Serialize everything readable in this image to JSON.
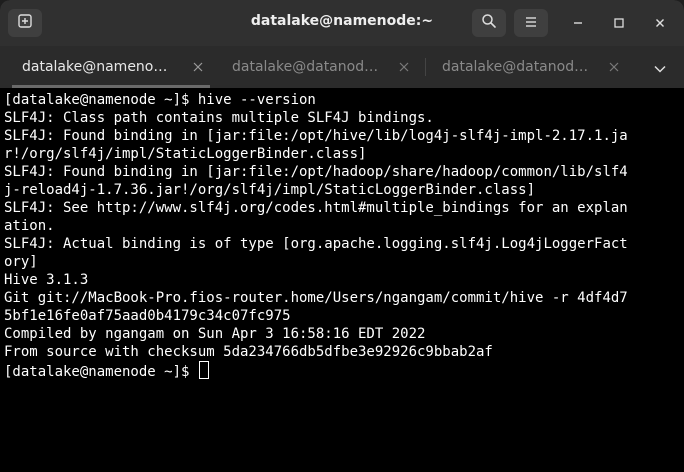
{
  "window": {
    "title": "datalake@namenode:~"
  },
  "header": {
    "new_tab_icon": "new-tab-icon",
    "search_icon": "search-icon",
    "menu_icon": "hamburger-menu-icon",
    "minimize_icon": "minimize-icon",
    "maximize_icon": "maximize-icon",
    "close_icon": "close-icon"
  },
  "tabs": [
    {
      "label": "datalake@nameno…",
      "active": true
    },
    {
      "label": "datalake@datanod…",
      "active": false
    },
    {
      "label": "datalake@datanod…",
      "active": false
    }
  ],
  "terminal": {
    "lines": [
      "[datalake@namenode ~]$ hive --version",
      "SLF4J: Class path contains multiple SLF4J bindings.",
      "SLF4J: Found binding in [jar:file:/opt/hive/lib/log4j-slf4j-impl-2.17.1.ja",
      "r!/org/slf4j/impl/StaticLoggerBinder.class]",
      "SLF4J: Found binding in [jar:file:/opt/hadoop/share/hadoop/common/lib/slf4",
      "j-reload4j-1.7.36.jar!/org/slf4j/impl/StaticLoggerBinder.class]",
      "SLF4J: See http://www.slf4j.org/codes.html#multiple_bindings for an explan",
      "ation.",
      "SLF4J: Actual binding is of type [org.apache.logging.slf4j.Log4jLoggerFact",
      "ory]",
      "Hive 3.1.3",
      "Git git://MacBook-Pro.fios-router.home/Users/ngangam/commit/hive -r 4df4d7",
      "5bf1e16fe0af75aad0b4179c34c07fc975",
      "Compiled by ngangam on Sun Apr 3 16:58:16 EDT 2022",
      "From source with checksum 5da234766db5dfbe3e92926c9bbab2af"
    ],
    "prompt": "[datalake@namenode ~]$ "
  },
  "colors": {
    "terminal_bg": "#000000",
    "terminal_fg": "#ffffff",
    "headerbar_bg": "#303030",
    "tabbar_bg": "#2b2b2b"
  }
}
